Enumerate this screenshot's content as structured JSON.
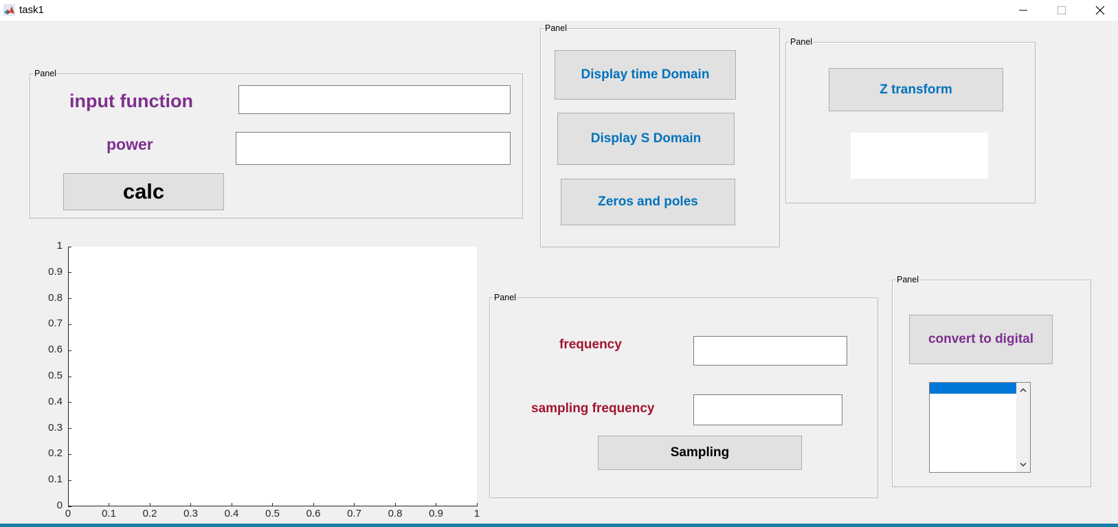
{
  "window": {
    "title": "task1",
    "icon": "matlab-icon",
    "controls": [
      "minimize-icon",
      "maximize-icon",
      "close-icon"
    ]
  },
  "panel_input": {
    "title": "Panel",
    "input_function_label": "input function",
    "input_function_value": "",
    "power_label": "power",
    "power_value": "",
    "calc_label": "calc"
  },
  "panel_display": {
    "title": "Panel",
    "time_domain_label": "Display time Domain",
    "s_domain_label": "Display S Domain",
    "zeros_poles_label": "Zeros and poles"
  },
  "panel_z": {
    "title": "Panel",
    "z_transform_label": "Z transform",
    "output_value": ""
  },
  "panel_sampling": {
    "title": "Panel",
    "frequency_label": "frequency",
    "frequency_value": "",
    "sampling_frequency_label": "sampling frequency",
    "sampling_frequency_value": "",
    "sampling_label": "Sampling"
  },
  "panel_digital": {
    "title": "Panel",
    "convert_label": "convert to digital",
    "list_items": [
      ""
    ]
  },
  "chart_data": {
    "type": "line",
    "series": [],
    "xlim": [
      0,
      1
    ],
    "ylim": [
      0,
      1
    ],
    "xticks": [
      "0",
      "0.1",
      "0.2",
      "0.3",
      "0.4",
      "0.5",
      "0.6",
      "0.7",
      "0.8",
      "0.9",
      "1"
    ],
    "yticks": [
      "0",
      "0.1",
      "0.2",
      "0.3",
      "0.4",
      "0.5",
      "0.6",
      "0.7",
      "0.8",
      "0.9",
      "1"
    ],
    "grid": false,
    "title": "",
    "xlabel": "",
    "ylabel": ""
  },
  "colors": {
    "purple_text": "#7e2f8e",
    "blue_text": "#0072bd",
    "red_text": "#a2142f",
    "button_bg": "#e1e1e1",
    "selection": "#0078d7"
  }
}
